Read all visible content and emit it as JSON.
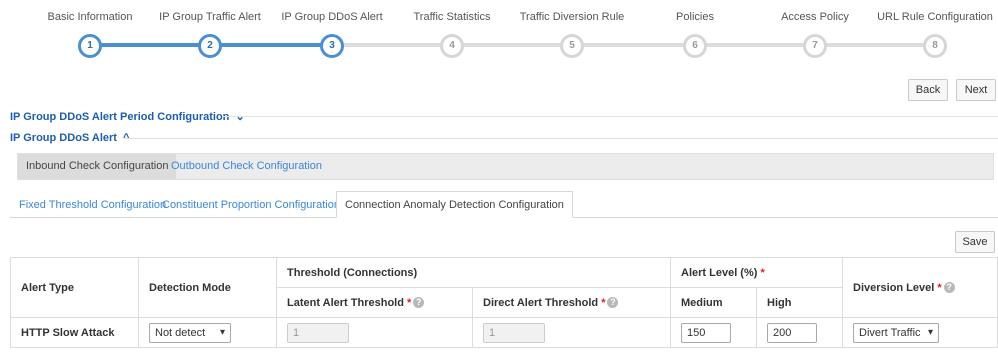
{
  "wizard": {
    "steps": [
      {
        "label": "Basic Information",
        "num": "1"
      },
      {
        "label": "IP Group Traffic Alert",
        "num": "2"
      },
      {
        "label": "IP Group DDoS Alert",
        "num": "3"
      },
      {
        "label": "Traffic Statistics",
        "num": "4"
      },
      {
        "label": "Traffic Diversion Rule",
        "num": "5"
      },
      {
        "label": "Policies",
        "num": "6"
      },
      {
        "label": "Access Policy",
        "num": "7"
      },
      {
        "label": "URL Rule Configuration",
        "num": "8"
      }
    ],
    "current_step": 3
  },
  "nav": {
    "back_label": "Back",
    "next_label": "Next"
  },
  "sections": {
    "period_title": "IP Group DDoS Alert Period Configuration",
    "period_chevron": "⌄",
    "alert_title": "IP Group DDoS Alert",
    "alert_chevron": "^"
  },
  "direction_tabs": {
    "inbound": "Inbound Check Configuration",
    "outbound": "Outbound Check Configuration"
  },
  "sub_tabs": {
    "fixed": "Fixed Threshold Configuration",
    "constituent": "Constituent Proportion Configuration",
    "connection": "Connection Anomaly Detection Configuration"
  },
  "save_label": "Save",
  "table": {
    "headers": {
      "alert_type": "Alert Type",
      "detection_mode": "Detection Mode",
      "threshold_group": "Threshold (Connections)",
      "latent": "Latent Alert Threshold",
      "direct": "Direct Alert Threshold",
      "alert_level": "Alert Level (%)",
      "medium": "Medium",
      "high": "High",
      "diversion_level": "Diversion Level",
      "required_mark": "*",
      "help_mark": "?"
    },
    "rows": [
      {
        "alert_type": "HTTP Slow Attack",
        "detection_mode": "Not detect",
        "latent": "1",
        "direct": "1",
        "medium": "150",
        "high": "200",
        "diversion_level": "Divert Traffic"
      }
    ]
  },
  "colors": {
    "accent": "#4a8fd1",
    "link": "#3b87d6",
    "title": "#1d5ea8",
    "required": "#e01b1b"
  }
}
